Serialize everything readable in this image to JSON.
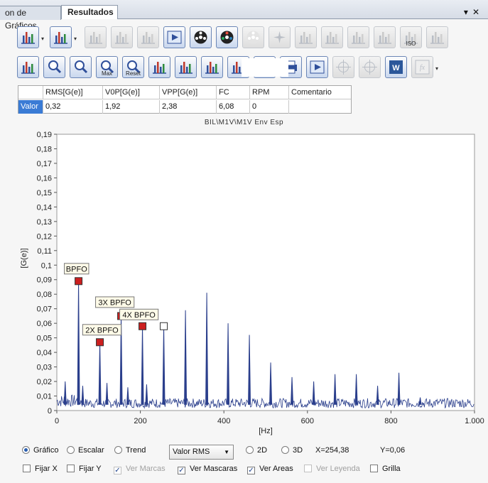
{
  "tabs": [
    {
      "label": "on de Gráficos",
      "active": false
    },
    {
      "label": "Resultados",
      "active": true
    }
  ],
  "window_controls": {
    "menu": "▾",
    "close": "✕"
  },
  "toolbar1": [
    {
      "icon": "spectrum-config-icon",
      "disabled": false,
      "dropdown": true
    },
    {
      "icon": "spectrum-select-icon",
      "disabled": false,
      "dropdown": true
    },
    {
      "icon": "bars-icon",
      "disabled": true
    },
    {
      "icon": "export-icon",
      "disabled": true
    },
    {
      "icon": "waterfall-icon",
      "disabled": true
    },
    {
      "icon": "next-icon",
      "disabled": false
    },
    {
      "icon": "film-reel-icon",
      "disabled": false
    },
    {
      "icon": "color-film-icon",
      "disabled": false
    },
    {
      "icon": "tape-icon",
      "disabled": true
    },
    {
      "icon": "sparkle-icon",
      "disabled": true
    },
    {
      "icon": "bearing-icon",
      "disabled": true
    },
    {
      "icon": "gauge-icon",
      "disabled": true
    },
    {
      "icon": "chart-settings-icon",
      "disabled": true
    },
    {
      "icon": "stamp-icon",
      "disabled": true
    },
    {
      "icon": "iso-icon",
      "disabled": true,
      "text": "ISO"
    },
    {
      "icon": "filter-icon",
      "disabled": true
    }
  ],
  "toolbar2": [
    {
      "icon": "tools-icon",
      "disabled": false
    },
    {
      "icon": "zoom-in-icon",
      "disabled": false
    },
    {
      "icon": "zoom-down-icon",
      "disabled": false
    },
    {
      "icon": "zoom-max-icon",
      "disabled": false,
      "text": "Max"
    },
    {
      "icon": "zoom-reset-icon",
      "disabled": false,
      "text": "Reset"
    },
    {
      "icon": "trend-chart-icon",
      "disabled": false
    },
    {
      "icon": "bar-chart-icon",
      "disabled": false
    },
    {
      "icon": "save-icon",
      "disabled": false
    },
    {
      "icon": "report-icon",
      "disabled": false
    },
    {
      "icon": "refresh-icon",
      "disabled": false
    },
    {
      "icon": "print-icon",
      "disabled": false
    },
    {
      "icon": "play-icon",
      "disabled": false
    },
    {
      "icon": "crosshair-icon",
      "disabled": true
    },
    {
      "icon": "crosshair-alt-icon",
      "disabled": true
    },
    {
      "icon": "word-export-icon",
      "disabled": false
    },
    {
      "icon": "formula-icon",
      "disabled": true,
      "dropdown": true
    }
  ],
  "results_table": {
    "columns": [
      "RMS[G(e)]",
      "V0P[G(e)]",
      "VPP[G(e)]",
      "FC",
      "RPM",
      "Comentario"
    ],
    "row_label": "Valor",
    "values": [
      "0,32",
      "1,92",
      "2,38",
      "6,08",
      "0",
      ""
    ]
  },
  "chart_title": "BIL\\M1V\\M1V Env Esp",
  "chart_data": {
    "type": "line",
    "title": "BIL\\M1V\\M1V Env Esp",
    "xlabel": "[Hz]",
    "ylabel": "[G(e)]",
    "xlim": [
      0,
      1000
    ],
    "ylim": [
      0,
      0.19
    ],
    "x_ticks": [
      "0",
      "200",
      "400",
      "600",
      "800",
      "1.000"
    ],
    "y_ticks": [
      "0",
      "0,01",
      "0,02",
      "0,03",
      "0,04",
      "0,05",
      "0,06",
      "0,07",
      "0,08",
      "0,09",
      "0,1",
      "0,11",
      "0,12",
      "0,13",
      "0,14",
      "0,15",
      "0,16",
      "0,17",
      "0,18",
      "0,19"
    ],
    "series_color": "#2b3f8c",
    "noise_floor": 0.006,
    "peaks": [
      {
        "x": 52,
        "y": 0.089
      },
      {
        "x": 103,
        "y": 0.047
      },
      {
        "x": 154,
        "y": 0.066
      },
      {
        "x": 205,
        "y": 0.058
      },
      {
        "x": 256,
        "y": 0.058
      },
      {
        "x": 308,
        "y": 0.069
      },
      {
        "x": 359,
        "y": 0.081
      },
      {
        "x": 410,
        "y": 0.06
      },
      {
        "x": 461,
        "y": 0.052
      },
      {
        "x": 512,
        "y": 0.033
      },
      {
        "x": 563,
        "y": 0.023
      },
      {
        "x": 615,
        "y": 0.02
      },
      {
        "x": 666,
        "y": 0.025
      },
      {
        "x": 717,
        "y": 0.025
      },
      {
        "x": 768,
        "y": 0.017
      },
      {
        "x": 819,
        "y": 0.026
      },
      {
        "x": 870,
        "y": 0.009
      },
      {
        "x": 20,
        "y": 0.02
      },
      {
        "x": 62,
        "y": 0.017
      },
      {
        "x": 120,
        "y": 0.019
      },
      {
        "x": 170,
        "y": 0.016
      },
      {
        "x": 215,
        "y": 0.018
      }
    ],
    "markers": [
      {
        "x": 52,
        "y": 0.089,
        "label": "BPFO",
        "style": "filled"
      },
      {
        "x": 103,
        "y": 0.047,
        "label": "2X BPFO",
        "style": "filled"
      },
      {
        "x": 154,
        "y": 0.065,
        "label": "3X BPFO",
        "style": "filled"
      },
      {
        "x": 205,
        "y": 0.058,
        "label": "4X BPFO",
        "style": "filled"
      },
      {
        "x": 256,
        "y": 0.058,
        "label": "",
        "style": "open"
      }
    ],
    "grid": false,
    "legend": "none"
  },
  "controls": {
    "radios": [
      {
        "label": "Gráfico",
        "checked": true
      },
      {
        "label": "Escalar",
        "checked": false
      },
      {
        "label": "Trend",
        "checked": false
      }
    ],
    "value_select": "Valor RMS",
    "dim_radios": [
      {
        "label": "2D",
        "checked": false
      },
      {
        "label": "3D",
        "checked": false
      }
    ],
    "x_readout": "X=254,38",
    "y_readout": "Y=0,06",
    "checks": [
      {
        "label": "Fijar X",
        "checked": false,
        "disabled": false
      },
      {
        "label": "Fijar Y",
        "checked": false,
        "disabled": false
      },
      {
        "label": "Ver Marcas",
        "checked": true,
        "disabled": true
      },
      {
        "label": "Ver Mascaras",
        "checked": true,
        "disabled": false
      },
      {
        "label": "Ver Areas",
        "checked": true,
        "disabled": false
      },
      {
        "label": "Ver Leyenda",
        "checked": false,
        "disabled": true
      },
      {
        "label": "Grilla",
        "checked": false,
        "disabled": false
      }
    ]
  }
}
